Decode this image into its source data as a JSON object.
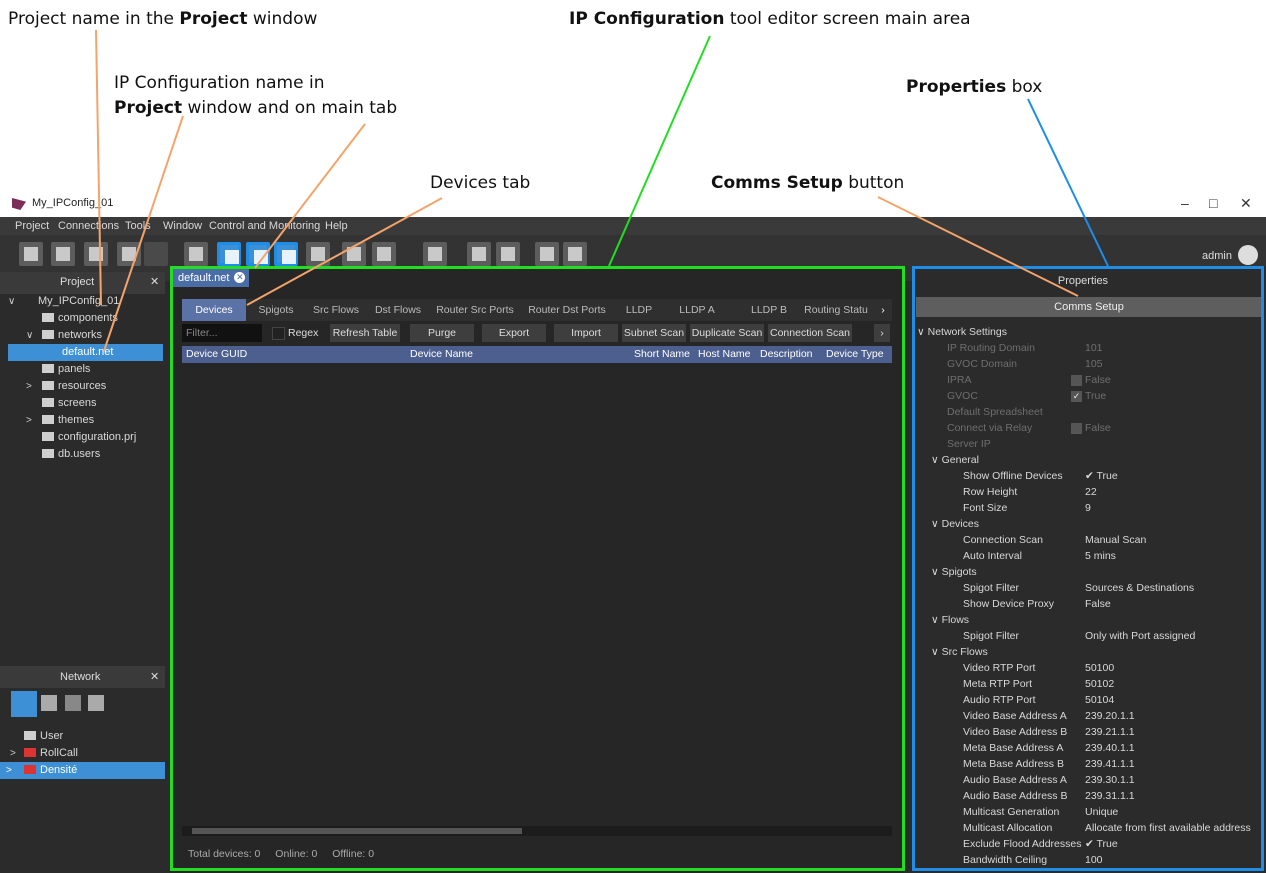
{
  "annotations": {
    "project_name": {
      "pre": "Project name in the ",
      "bold": "Project",
      "post": " window"
    },
    "ipconfig_name_line1": "IP Configuration name in",
    "ipconfig_name_line2": {
      "bold": "Project",
      "post": " window and on main tab"
    },
    "devices_tab": "Devices tab",
    "editor_area": {
      "bold": "IP Configuration",
      "post": " tool editor screen main area"
    },
    "comms_setup": {
      "bold": "Comms Setup",
      "post": " button"
    },
    "properties_box": {
      "bold": "Properties",
      "post": " box"
    }
  },
  "window": {
    "title": "My_IPConfig_01",
    "minimize": "–",
    "maximize": "□",
    "close": "✕"
  },
  "menu": [
    "Project",
    "Connections",
    "Tools",
    "Window",
    "Control and Monitoring",
    "Help"
  ],
  "user": "admin",
  "project_panel": {
    "title": "Project",
    "root": "My_IPConfig_01",
    "items": [
      "components",
      "networks",
      "default.net",
      "panels",
      "resources",
      "screens",
      "themes",
      "configuration.prj",
      "db.users"
    ]
  },
  "network_panel": {
    "title": "Network",
    "items": [
      "User",
      "RollCall",
      "Densité"
    ]
  },
  "editor": {
    "doc_tab": "default.net",
    "tabs": [
      "Devices",
      "Spigots",
      "Src Flows",
      "Dst Flows",
      "Router Src Ports",
      "Router Dst Ports",
      "LLDP",
      "LLDP A",
      "LLDP B",
      "Routing Statu"
    ],
    "filter_placeholder": "Filter...",
    "regex": "Regex",
    "buttons": [
      "Refresh Table",
      "Purge",
      "Export",
      "Import",
      "Subnet Scan",
      "Duplicate Scan",
      "Connection Scan"
    ],
    "columns": [
      "Device GUID",
      "Device Name",
      "Short Name",
      "Host Name",
      "Description",
      "Device Type"
    ],
    "status": {
      "total": "Total devices: 0",
      "online": "Online: 0",
      "offline": "Offline: 0"
    }
  },
  "properties": {
    "title": "Properties",
    "comms_button": "Comms Setup",
    "section": "Network Settings",
    "rows": [
      {
        "label": "IP Routing Domain",
        "value": "101",
        "dim": true
      },
      {
        "label": "GVOC Domain",
        "value": "105",
        "dim": true
      },
      {
        "label": "IPRA",
        "value": "False",
        "dim": true,
        "check": "empty"
      },
      {
        "label": "GVOC",
        "value": "True",
        "dim": true,
        "check": "tick"
      },
      {
        "label": "Default Spreadsheet",
        "value": "",
        "dim": true
      },
      {
        "label": "Connect via Relay",
        "value": "False",
        "dim": true,
        "check": "empty"
      },
      {
        "label": "Server IP",
        "value": "",
        "dim": true
      }
    ],
    "groups": [
      {
        "name": "General",
        "rows": [
          {
            "label": "Show Offline Devices",
            "value": "✔ True"
          },
          {
            "label": "Row Height",
            "value": "22"
          },
          {
            "label": "Font Size",
            "value": "9"
          }
        ]
      },
      {
        "name": "Devices",
        "rows": [
          {
            "label": "Connection Scan",
            "value": "Manual Scan"
          },
          {
            "label": "Auto Interval",
            "value": "5 mins"
          }
        ]
      },
      {
        "name": "Spigots",
        "rows": [
          {
            "label": "Spigot Filter",
            "value": "Sources & Destinations"
          },
          {
            "label": "Show Device Proxy",
            "value": "False"
          }
        ]
      },
      {
        "name": "Flows",
        "rows": [
          {
            "label": "Spigot Filter",
            "value": "Only with Port assigned"
          }
        ]
      },
      {
        "name": "Src Flows",
        "rows": [
          {
            "label": "Video RTP Port",
            "value": "50100"
          },
          {
            "label": "Meta RTP Port",
            "value": "50102"
          },
          {
            "label": "Audio RTP Port",
            "value": "50104"
          },
          {
            "label": "Video Base Address A",
            "value": "239.20.1.1"
          },
          {
            "label": "Video Base Address B",
            "value": "239.21.1.1"
          },
          {
            "label": "Meta Base Address A",
            "value": "239.40.1.1"
          },
          {
            "label": "Meta Base Address B",
            "value": "239.41.1.1"
          },
          {
            "label": "Audio Base Address A",
            "value": "239.30.1.1"
          },
          {
            "label": "Audio Base Address B",
            "value": "239.31.1.1"
          },
          {
            "label": "Multicast Generation",
            "value": "Unique"
          },
          {
            "label": "Multicast Allocation",
            "value": "Allocate from first available address"
          },
          {
            "label": "Exclude Flood Addresses",
            "value": "✔ True"
          },
          {
            "label": "Bandwidth Ceiling",
            "value": "100"
          }
        ]
      }
    ]
  }
}
